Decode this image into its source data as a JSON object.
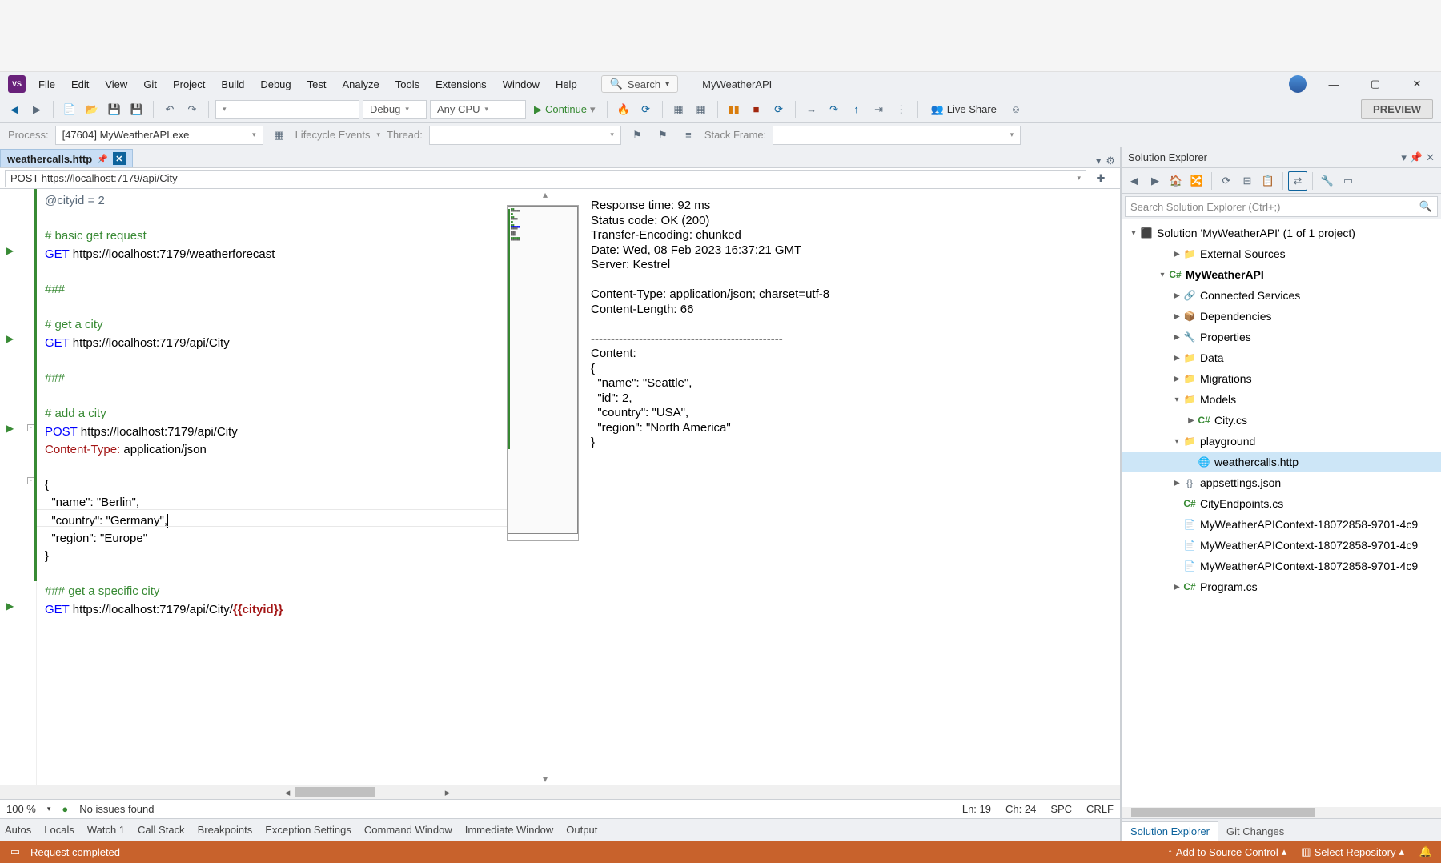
{
  "menus": [
    "File",
    "Edit",
    "View",
    "Git",
    "Project",
    "Build",
    "Debug",
    "Test",
    "Analyze",
    "Tools",
    "Extensions",
    "Window",
    "Help"
  ],
  "search_placeholder": "Search",
  "app_name": "MyWeatherAPI",
  "toolbar": {
    "config": "Debug",
    "platform": "Any CPU",
    "continue": "Continue",
    "liveshare": "Live Share",
    "preview": "PREVIEW"
  },
  "debugbar": {
    "process_label": "Process:",
    "process_value": "[47604] MyWeatherAPI.exe",
    "lifecycle": "Lifecycle Events",
    "thread_label": "Thread:",
    "stackframe_label": "Stack Frame:"
  },
  "tab": {
    "filename": "weathercalls.http"
  },
  "navbar_value": "POST https://localhost:7179/api/City",
  "code": {
    "l1": "@cityid = 2",
    "l2": "# basic get request",
    "l3a": "GET",
    "l3b": " https://localhost:7179/weatherforecast",
    "l4": "###",
    "l5": "# get a city",
    "l6a": "GET",
    "l6b": " https://localhost:7179/api/City",
    "l7": "###",
    "l8": "# add a city",
    "l9a": "POST",
    "l9b": " https://localhost:7179/api/City",
    "l10a": "Content-Type:",
    "l10b": " application/json",
    "l11": "{",
    "l12": "  \"name\": \"Berlin\",",
    "l13": "  \"country\": \"Germany\",",
    "l14": "  \"region\": \"Europe\"",
    "l15": "}",
    "l16": "### get a specific city",
    "l17a": "GET",
    "l17b": " https://localhost:7179/api/City/",
    "l17c": "{{cityid}}"
  },
  "response": {
    "rt": "Response time: 92 ms",
    "sc": "Status code: OK (200)",
    "te": "Transfer-Encoding: chunked",
    "dt": "Date: Wed, 08 Feb 2023 16:37:21 GMT",
    "sv": "Server: Kestrel",
    "ct": "Content-Type: application/json; charset=utf-8",
    "cl": "Content-Length: 66",
    "sep": "------------------------------------------------",
    "ch": "Content:",
    "b1": "{",
    "b2": "  \"name\": \"Seattle\",",
    "b3": "  \"id\": 2,",
    "b4": "  \"country\": \"USA\",",
    "b5": "  \"region\": \"North America\"",
    "b6": "}"
  },
  "editor_status": {
    "zoom": "100 %",
    "issues": "No issues found",
    "ln": "Ln: 19",
    "ch": "Ch: 24",
    "spc": "SPC",
    "crlf": "CRLF"
  },
  "solexp": {
    "title": "Solution Explorer",
    "search_placeholder": "Search Solution Explorer (Ctrl+;)",
    "solution": "Solution 'MyWeatherAPI' (1 of 1 project)",
    "project": "MyWeatherAPI",
    "items": [
      {
        "lbl": "External Sources",
        "indent": 3,
        "twist": "▶",
        "icon": "fold"
      },
      {
        "lbl": "MyWeatherAPI",
        "indent": 2,
        "twist": "▾",
        "icon": "cs",
        "bold": true
      },
      {
        "lbl": "Connected Services",
        "indent": 3,
        "twist": "▶",
        "icon": "serv"
      },
      {
        "lbl": "Dependencies",
        "indent": 3,
        "twist": "▶",
        "icon": "dep"
      },
      {
        "lbl": "Properties",
        "indent": 3,
        "twist": "▶",
        "icon": "prop"
      },
      {
        "lbl": "Data",
        "indent": 3,
        "twist": "▶",
        "icon": "fold"
      },
      {
        "lbl": "Migrations",
        "indent": 3,
        "twist": "▶",
        "icon": "fold"
      },
      {
        "lbl": "Models",
        "indent": 3,
        "twist": "▾",
        "icon": "fold"
      },
      {
        "lbl": "City.cs",
        "indent": 4,
        "twist": "▶",
        "icon": "cs"
      },
      {
        "lbl": "playground",
        "indent": 3,
        "twist": "▾",
        "icon": "fold"
      },
      {
        "lbl": "weathercalls.http",
        "indent": 4,
        "twist": "",
        "icon": "http",
        "selected": true
      },
      {
        "lbl": "appsettings.json",
        "indent": 3,
        "twist": "▶",
        "icon": "json"
      },
      {
        "lbl": "CityEndpoints.cs",
        "indent": 3,
        "twist": "",
        "icon": "cs"
      },
      {
        "lbl": "MyWeatherAPIContext-18072858-9701-4c9",
        "indent": 3,
        "twist": "",
        "icon": "file"
      },
      {
        "lbl": "MyWeatherAPIContext-18072858-9701-4c9",
        "indent": 3,
        "twist": "",
        "icon": "file"
      },
      {
        "lbl": "MyWeatherAPIContext-18072858-9701-4c9",
        "indent": 3,
        "twist": "",
        "icon": "file"
      },
      {
        "lbl": "Program.cs",
        "indent": 3,
        "twist": "▶",
        "icon": "cs"
      }
    ],
    "tab_active": "Solution Explorer",
    "tab_other": "Git Changes"
  },
  "tool_tabs": [
    "Autos",
    "Locals",
    "Watch 1",
    "Call Stack",
    "Breakpoints",
    "Exception Settings",
    "Command Window",
    "Immediate Window",
    "Output"
  ],
  "statusbar": {
    "msg": "Request completed",
    "src_control": "Add to Source Control",
    "repo": "Select Repository"
  }
}
